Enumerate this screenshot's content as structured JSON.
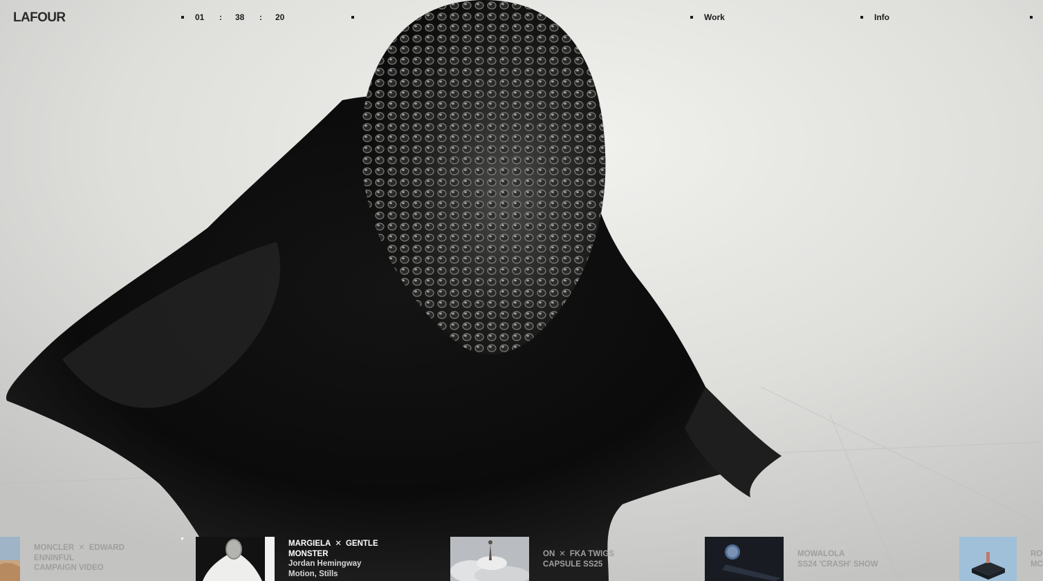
{
  "brand": "LAFOUR",
  "clock": {
    "hours": "01",
    "minutes": "38",
    "seconds": "20",
    "separator": ":"
  },
  "nav": {
    "work": "Work",
    "info": "Info"
  },
  "carousel": [
    {
      "title_a": "MONCLER",
      "cross": "✕",
      "title_b": "EDWARD ENNINFUL",
      "title_c": "CAMPAIGN VIDEO",
      "active": false
    },
    {
      "title_a": "MARGIELA",
      "cross": "✕",
      "title_b": "GENTLE MONSTER",
      "credit": "Jordan Hemingway",
      "tags": "Motion, Stills",
      "active": true
    },
    {
      "title_a": "ON",
      "cross": "✕",
      "title_b": "FKA TWIGS",
      "title_c": "CAPSULE SS25",
      "active": false
    },
    {
      "title_a": "MOWALOLA",
      "title_b": "SS24 'CRASH' SHOW",
      "active": false
    },
    {
      "title_a": "RO",
      "title_b": "MC",
      "active": false
    }
  ],
  "colors": {
    "accent": "#1a1a1a",
    "caption_inactive": "#9ea09e",
    "caption_active": "#ffffff"
  }
}
